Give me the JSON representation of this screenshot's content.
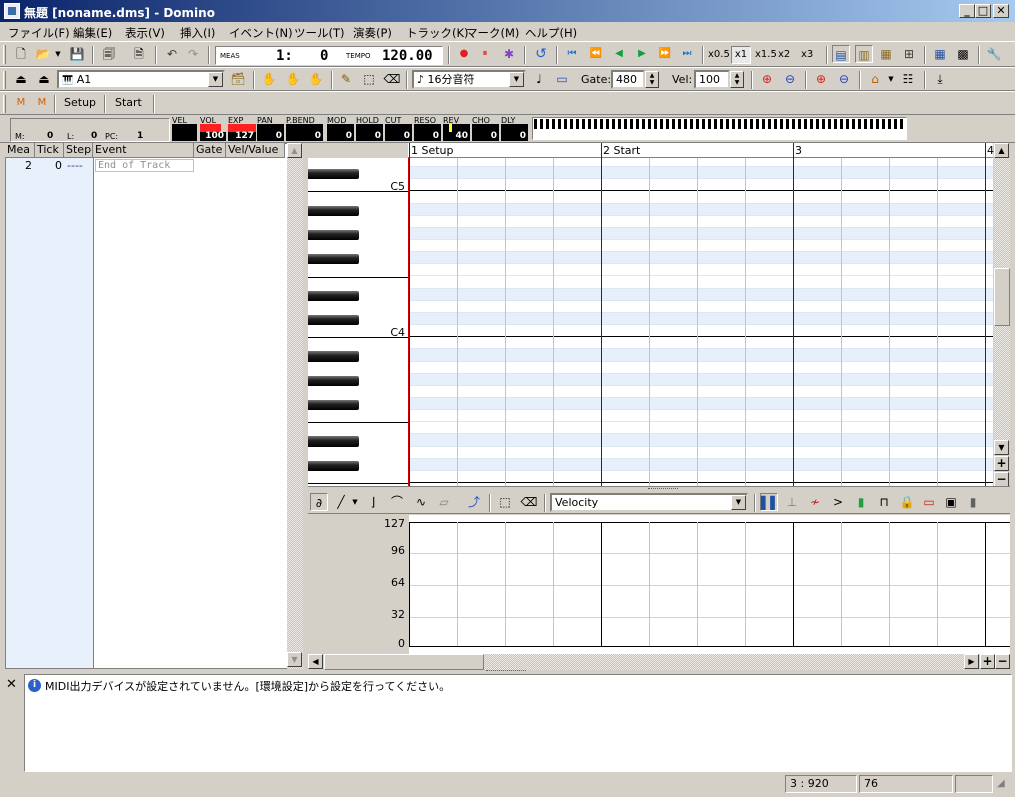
{
  "window": {
    "title": "無題 [noname.dms] - Domino",
    "min": "_",
    "max": "□",
    "close": "✕"
  },
  "menu": [
    "ファイル(F)",
    "編集(E)",
    "表示(V)",
    "挿入(I)",
    "イベント(N)",
    "ツール(T)",
    "演奏(P)",
    "トラック(K)",
    "マーク(M)",
    "ヘルプ(H)"
  ],
  "transport": {
    "meas_label": "MEAS",
    "meas_value": "1:",
    "tick_value": "0",
    "tempo_label": "TEMPO",
    "tempo_value": "120.00"
  },
  "speed": [
    "x0.5",
    "x1",
    "x1.5",
    "x2",
    "x3"
  ],
  "track_select": "A1",
  "note_length": "16分音符",
  "gate": {
    "label": "Gate:",
    "value": "480"
  },
  "vel": {
    "label": "Vel:",
    "value": "100"
  },
  "markers": [
    "Setup",
    "Start"
  ],
  "position": {
    "m_label": "M:",
    "m_value": "0",
    "l_label": "L:",
    "l_value": "0",
    "pc_label": "PC:",
    "pc_value": "1"
  },
  "meters": [
    {
      "label": "VEL",
      "value": ""
    },
    {
      "label": "VOL",
      "value": "100"
    },
    {
      "label": "EXP",
      "value": "127"
    },
    {
      "label": "PAN",
      "value": "0"
    },
    {
      "label": "P.BEND",
      "value": "0"
    },
    {
      "label": "MOD",
      "value": "0"
    },
    {
      "label": "HOLD",
      "value": "0"
    },
    {
      "label": "CUT",
      "value": "0"
    },
    {
      "label": "RESO",
      "value": "0"
    },
    {
      "label": "REV",
      "value": "40"
    },
    {
      "label": "CHO",
      "value": "0"
    },
    {
      "label": "DLY",
      "value": "0"
    }
  ],
  "event_list": {
    "headers": [
      "Mea",
      "Tick",
      "Step",
      "Event",
      "Gate",
      "Vel/Value"
    ],
    "rows": [
      {
        "mea": "2",
        "tick": "0",
        "step": "----",
        "event": "End of Track"
      }
    ]
  },
  "measures": [
    {
      "num": "1",
      "name": "Setup"
    },
    {
      "num": "2",
      "name": "Start"
    },
    {
      "num": "3",
      "name": ""
    },
    {
      "num": "4",
      "name": ""
    }
  ],
  "piano": {
    "labels": [
      "C5",
      "C4"
    ],
    "top_pitch": 86,
    "bottom_pitch": 59
  },
  "controller": {
    "select": "Velocity",
    "ticks": [
      "127",
      "96",
      "64",
      "32",
      "0"
    ]
  },
  "info_message": "MIDI出力デバイスが設定されていません。[環境設定]から設定を行ってください。",
  "statusbar": [
    "3 : 920",
    "76",
    ""
  ],
  "colors": {
    "meter_red": "#ff2020",
    "meter_yellow": "#ffff40",
    "measure_line": "#1a237e",
    "title_start": "#0a246a"
  }
}
